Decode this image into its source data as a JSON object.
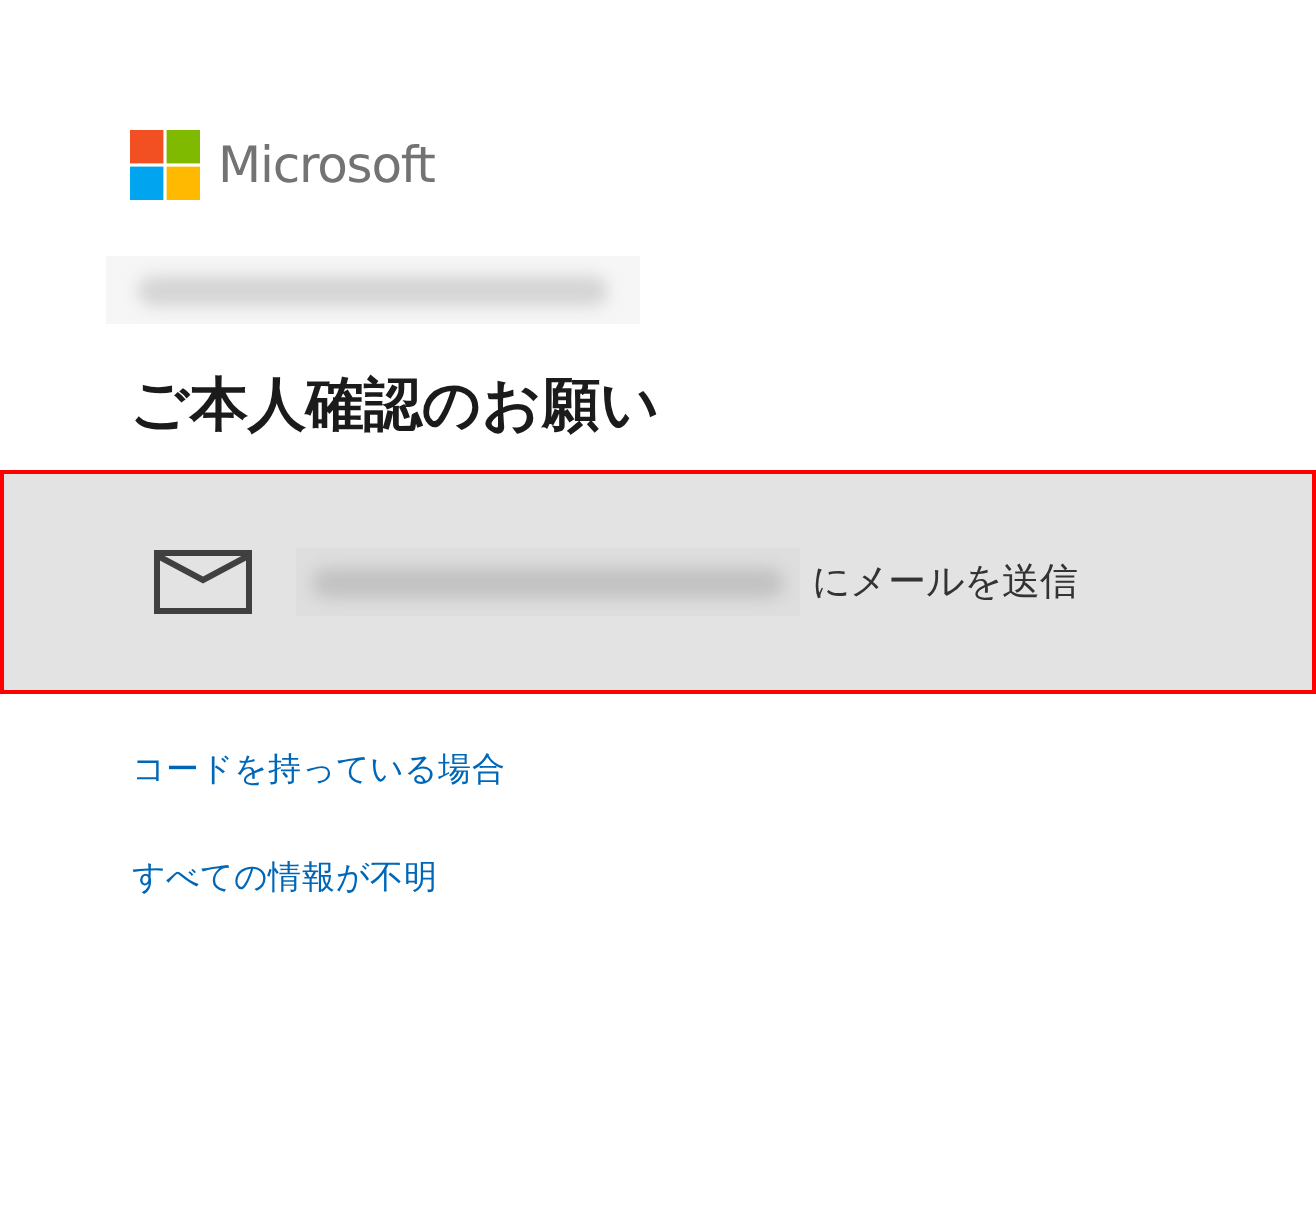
{
  "logo": {
    "text": "Microsoft"
  },
  "account": {
    "email_blurred": true
  },
  "heading": "ご本人確認のお願い",
  "options": [
    {
      "kind": "email",
      "email_blurred": true,
      "label": "にメールを送信",
      "highlighted": true
    }
  ],
  "links": [
    "コードを持っている場合",
    "すべての情報が不明"
  ]
}
